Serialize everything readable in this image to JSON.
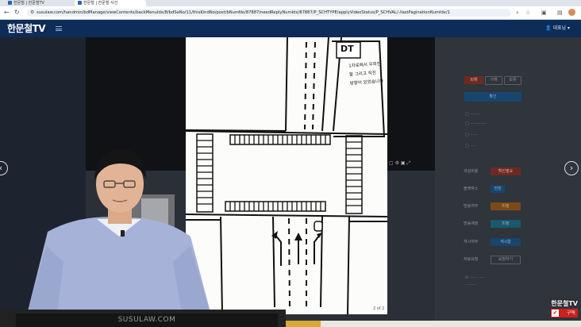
{
  "browser": {
    "tabs": [
      {
        "label": "한문철 | 한문철TV"
      },
      {
        "label": "한문철 | 한문철 사건"
      }
    ],
    "url": "susulaw.com/handmin/bdManage/viewContents/backMenuIdx/8/bdSeNo/11/thisKindNo/post/bNumNo/87887/needReplyNumIdx/87887/P_SCHTYPE/applyVideoStatus/P_SCHVAL/-/lastPaginationNumIdx/1",
    "icons": [
      "back-icon",
      "reload-icon",
      "zoom-icon",
      "star-icon",
      "extension-icon",
      "profile-icon"
    ]
  },
  "header": {
    "logo": "한문철TV",
    "user": "👤 대표님 ▾"
  },
  "drawing": {
    "sign_label": "DT",
    "note_lines": [
      "1차로에서 우회전",
      "할 그리고 직진",
      "방향이 있었습니다"
    ]
  },
  "desk_sign": "SUSULAW.COM",
  "page_counter": "2 of 2",
  "overlay": {
    "channel": "한문철TV",
    "subscribe": "구독"
  },
  "sidebar": {
    "tabs": [
      "피해",
      "가해",
      "보류"
    ],
    "filter_btn": "확인",
    "rows": [
      {
        "label": "과실비율",
        "btn": "확인필요"
      },
      {
        "label": "블랙박스",
        "btn": "전방"
      },
      {
        "label": "방송여부",
        "btn": "미정"
      },
      {
        "label": "방송예정",
        "btn": "미정"
      },
      {
        "label": "게시여부",
        "btn": "게시함"
      },
      {
        "label": "자료요청",
        "btn": "요청하기"
      }
    ]
  },
  "colors": {
    "header": "#0d2c58",
    "accent_red": "#cc1f1f"
  }
}
